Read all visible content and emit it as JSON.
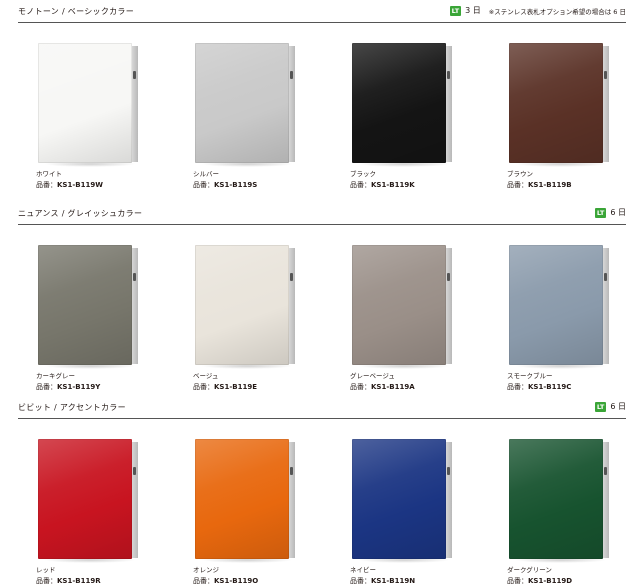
{
  "sections": [
    {
      "title": "モノトーン / ベーシックカラー",
      "lt_badge": "LT",
      "lt_days": "3 日",
      "note": "※ステンレス表札オプション希望の場合は 6 日",
      "items": [
        {
          "name": "ホワイト",
          "code_prefix": "品番：",
          "code": "KS1-B119W",
          "color": "#f7f7f5"
        },
        {
          "name": "シルバー",
          "code_prefix": "品番：",
          "code": "KS1-B119S",
          "color": "#c9c9c9"
        },
        {
          "name": "ブラック",
          "code_prefix": "品番：",
          "code": "KS1-B119K",
          "color": "#141414"
        },
        {
          "name": "ブラウン",
          "code_prefix": "品番：",
          "code": "KS1-B119B",
          "color": "#5a3126"
        }
      ]
    },
    {
      "title": "ニュアンス / グレイッシュカラー",
      "lt_badge": "LT",
      "lt_days": "6 日",
      "note": "",
      "items": [
        {
          "name": "カーキグレー",
          "code_prefix": "品番：",
          "code": "KS1-B119Y",
          "color": "#77766b"
        },
        {
          "name": "ベージュ",
          "code_prefix": "品番：",
          "code": "KS1-B119E",
          "color": "#e9e4db"
        },
        {
          "name": "グレーベージュ",
          "code_prefix": "品番：",
          "code": "KS1-B119A",
          "color": "#9a8f88"
        },
        {
          "name": "スモークブルー",
          "code_prefix": "品番：",
          "code": "KS1-B119C",
          "color": "#8a9aab"
        }
      ]
    },
    {
      "title": "ビビット / アクセントカラー",
      "lt_badge": "LT",
      "lt_days": "6 日",
      "note": "",
      "items": [
        {
          "name": "レッド",
          "code_prefix": "品番：",
          "code": "KS1-B119R",
          "color": "#c81420"
        },
        {
          "name": "オレンジ",
          "code_prefix": "品番：",
          "code": "KS1-B119O",
          "color": "#e8680e"
        },
        {
          "name": "ネイビー",
          "code_prefix": "品番：",
          "code": "KS1-B119N",
          "color": "#1b3583"
        },
        {
          "name": "ダークグリーン",
          "code_prefix": "品番：",
          "code": "KS1-B119D",
          "color": "#17532f"
        }
      ]
    }
  ]
}
